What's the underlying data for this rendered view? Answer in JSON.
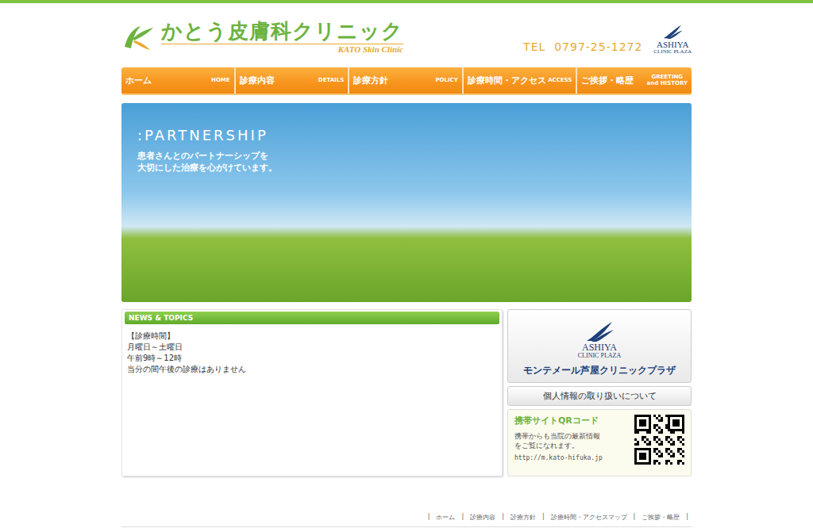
{
  "header": {
    "logo_title": "かとう皮膚科クリニック",
    "logo_subtitle": "KATO Skin Clinic",
    "tel": "TEL  0797-25-1272",
    "partner_logo": {
      "name": "ASHIYA",
      "sub": "CLINIC PLAZA"
    }
  },
  "nav": [
    {
      "label": "ホーム",
      "en": [
        "HOME"
      ]
    },
    {
      "label": "診療内容",
      "en": [
        "DETAILS"
      ]
    },
    {
      "label": "診療方針",
      "en": [
        "POLICY"
      ]
    },
    {
      "label": "診療時間・アクセス",
      "en": [
        "ACCESS"
      ]
    },
    {
      "label": "ご挨拶・略歴",
      "en": [
        "GREETING",
        "and HISTORY"
      ]
    }
  ],
  "banner": {
    "title": ":PARTNERSHIP",
    "lines": [
      "患者さんとのパートナーシップを",
      "大切にした治療を心がけています。"
    ]
  },
  "news": {
    "title": "NEWS & TOPICS",
    "lines": [
      "【診療時間】",
      "月曜日～土曜日",
      "午前9時～12時",
      "当分の間午後の診療はありません"
    ]
  },
  "sidebar": {
    "plaza_banner": {
      "name": "ASHIYA",
      "sub": "CLINIC PLAZA",
      "caption": "モンテメール芦屋クリニックプラザ"
    },
    "privacy_link": "個人情報の取り扱いについて",
    "qr": {
      "title": "携帯サイトQRコード",
      "lines": [
        "携帯からも当院の最新情報",
        "をご覧になれます。"
      ],
      "url": "http://m.kato-hifuka.jp"
    }
  },
  "footer": {
    "separator": "|",
    "links": [
      "ホーム",
      "診療内容",
      "診療方針",
      "診療時間・アクセスマップ",
      "ご挨拶・略歴"
    ]
  }
}
